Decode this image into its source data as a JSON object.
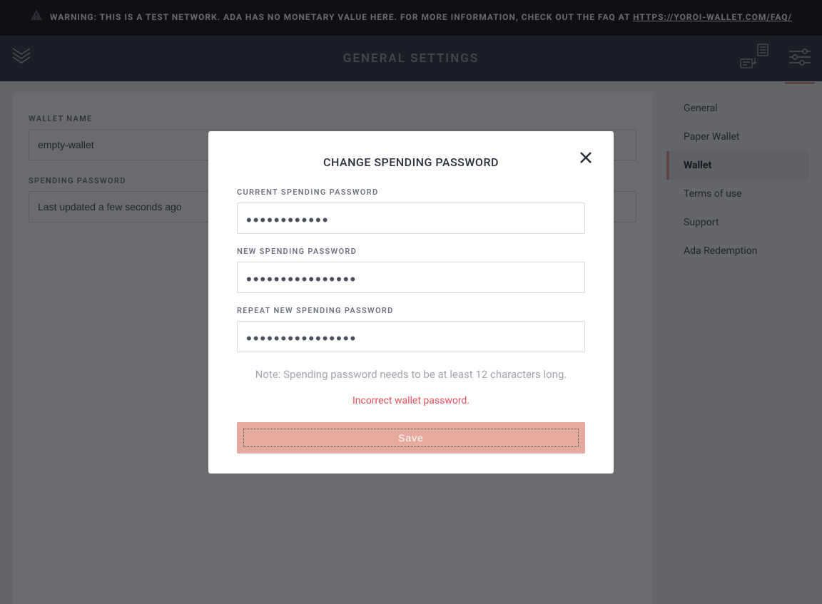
{
  "banner": {
    "text_prefix": "WARNING: THIS IS A TEST NETWORK. ADA HAS NO MONETARY VALUE HERE. FOR MORE INFORMATION, CHECK OUT THE FAQ AT ",
    "link_text": "HTTPS://YOROI-WALLET.COM/FAQ/"
  },
  "header": {
    "title": "GENERAL SETTINGS"
  },
  "settings": {
    "wallet_name_label": "WALLET NAME",
    "wallet_name_value": "empty-wallet",
    "spending_password_label": "SPENDING PASSWORD",
    "spending_password_value": "Last updated a few seconds ago"
  },
  "sidebar": {
    "items": [
      {
        "label": "General",
        "active": false
      },
      {
        "label": "Paper Wallet",
        "active": false
      },
      {
        "label": "Wallet",
        "active": true
      },
      {
        "label": "Terms of use",
        "active": false
      },
      {
        "label": "Support",
        "active": false
      },
      {
        "label": "Ada Redemption",
        "active": false
      }
    ]
  },
  "modal": {
    "title": "CHANGE SPENDING PASSWORD",
    "current_label": "CURRENT SPENDING PASSWORD",
    "current_value": "••••••••••••",
    "new_label": "NEW SPENDING PASSWORD",
    "new_value": "••••••••••••••••",
    "repeat_label": "REPEAT NEW SPENDING PASSWORD",
    "repeat_value": "••••••••••••••••",
    "note": "Note: Spending password needs to be at least 12 characters long.",
    "error": "Incorrect wallet password.",
    "save_label": "Save"
  }
}
